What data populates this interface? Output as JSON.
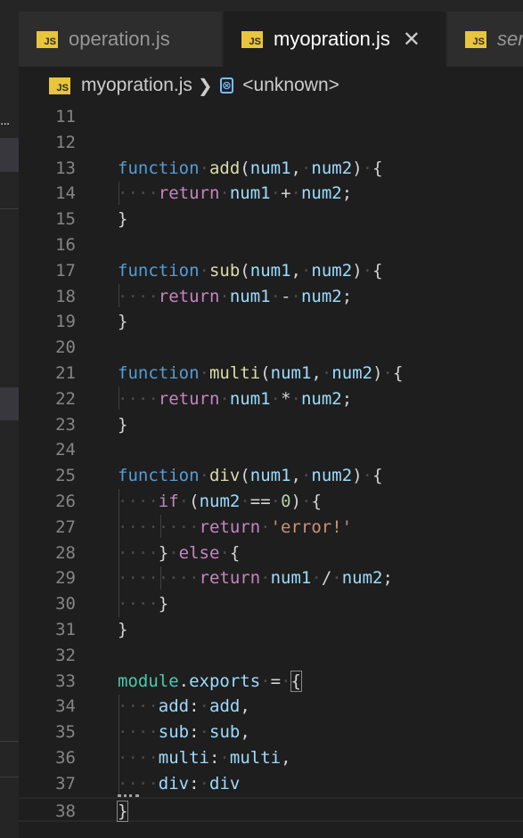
{
  "tabs": [
    {
      "label": "operation.js",
      "icon": "JS",
      "active": false
    },
    {
      "label": "myopration.js",
      "icon": "JS",
      "active": true,
      "close_glyph": "✕"
    },
    {
      "label": "ser",
      "icon": "JS",
      "active": false
    }
  ],
  "breadcrumb": {
    "file": "myopration.js",
    "icon": "JS",
    "separator": "❯",
    "symbol_icon": "⊗",
    "symbol": "<unknown>"
  },
  "sidebar": {
    "overflow": "..."
  },
  "editor": {
    "current_line": 38,
    "lines": [
      {
        "n": "11",
        "tokens": []
      },
      {
        "n": "12",
        "tokens": []
      },
      {
        "n": "13",
        "tokens": [
          [
            "kw",
            "function"
          ],
          [
            "ws",
            "·"
          ],
          [
            "fn",
            "add"
          ],
          [
            "op",
            "("
          ],
          [
            "pa",
            "num1"
          ],
          [
            "op",
            ","
          ],
          [
            "ws",
            "·"
          ],
          [
            "pa",
            "num2"
          ],
          [
            "op",
            ")"
          ],
          [
            "ws",
            "·"
          ],
          [
            "op",
            "{"
          ]
        ]
      },
      {
        "n": "14",
        "tokens": [
          [
            "ws",
            "····"
          ],
          [
            "kc",
            "return"
          ],
          [
            "ws",
            "·"
          ],
          [
            "pa",
            "num1"
          ],
          [
            "ws",
            "·"
          ],
          [
            "op",
            "+"
          ],
          [
            "ws",
            "·"
          ],
          [
            "pa",
            "num2"
          ],
          [
            "op",
            ";"
          ]
        ]
      },
      {
        "n": "15",
        "tokens": [
          [
            "op",
            "}"
          ]
        ]
      },
      {
        "n": "16",
        "tokens": []
      },
      {
        "n": "17",
        "tokens": [
          [
            "kw",
            "function"
          ],
          [
            "ws",
            "·"
          ],
          [
            "fn",
            "sub"
          ],
          [
            "op",
            "("
          ],
          [
            "pa",
            "num1"
          ],
          [
            "op",
            ","
          ],
          [
            "ws",
            "·"
          ],
          [
            "pa",
            "num2"
          ],
          [
            "op",
            ")"
          ],
          [
            "ws",
            "·"
          ],
          [
            "op",
            "{"
          ]
        ]
      },
      {
        "n": "18",
        "tokens": [
          [
            "ws",
            "····"
          ],
          [
            "kc",
            "return"
          ],
          [
            "ws",
            "·"
          ],
          [
            "pa",
            "num1"
          ],
          [
            "ws",
            "·"
          ],
          [
            "op",
            "-"
          ],
          [
            "ws",
            "·"
          ],
          [
            "pa",
            "num2"
          ],
          [
            "op",
            ";"
          ]
        ]
      },
      {
        "n": "19",
        "tokens": [
          [
            "op",
            "}"
          ]
        ]
      },
      {
        "n": "20",
        "tokens": []
      },
      {
        "n": "21",
        "tokens": [
          [
            "kw",
            "function"
          ],
          [
            "ws",
            "·"
          ],
          [
            "fn",
            "multi"
          ],
          [
            "op",
            "("
          ],
          [
            "pa",
            "num1"
          ],
          [
            "op",
            ","
          ],
          [
            "ws",
            "·"
          ],
          [
            "pa",
            "num2"
          ],
          [
            "op",
            ")"
          ],
          [
            "ws",
            "·"
          ],
          [
            "op",
            "{"
          ]
        ]
      },
      {
        "n": "22",
        "tokens": [
          [
            "ws",
            "····"
          ],
          [
            "kc",
            "return"
          ],
          [
            "ws",
            "·"
          ],
          [
            "pa",
            "num1"
          ],
          [
            "ws",
            "·"
          ],
          [
            "op",
            "*"
          ],
          [
            "ws",
            "·"
          ],
          [
            "pa",
            "num2"
          ],
          [
            "op",
            ";"
          ]
        ]
      },
      {
        "n": "23",
        "tokens": [
          [
            "op",
            "}"
          ]
        ]
      },
      {
        "n": "24",
        "tokens": []
      },
      {
        "n": "25",
        "tokens": [
          [
            "kw",
            "function"
          ],
          [
            "ws",
            "·"
          ],
          [
            "fn",
            "div"
          ],
          [
            "op",
            "("
          ],
          [
            "pa",
            "num1"
          ],
          [
            "op",
            ","
          ],
          [
            "ws",
            "·"
          ],
          [
            "pa",
            "num2"
          ],
          [
            "op",
            ")"
          ],
          [
            "ws",
            "·"
          ],
          [
            "op",
            "{"
          ]
        ]
      },
      {
        "n": "26",
        "tokens": [
          [
            "ws",
            "····"
          ],
          [
            "kc",
            "if"
          ],
          [
            "ws",
            "·"
          ],
          [
            "op",
            "("
          ],
          [
            "pa",
            "num2"
          ],
          [
            "ws",
            "·"
          ],
          [
            "op",
            "=="
          ],
          [
            "ws",
            "·"
          ],
          [
            "nu",
            "0"
          ],
          [
            "op",
            ")"
          ],
          [
            "ws",
            "·"
          ],
          [
            "op",
            "{"
          ]
        ]
      },
      {
        "n": "27",
        "tokens": [
          [
            "ws",
            "········"
          ],
          [
            "kc",
            "return"
          ],
          [
            "ws",
            "·"
          ],
          [
            "st",
            "'error!'"
          ]
        ]
      },
      {
        "n": "28",
        "tokens": [
          [
            "ws",
            "····"
          ],
          [
            "op",
            "}"
          ],
          [
            "ws",
            "·"
          ],
          [
            "kc",
            "else"
          ],
          [
            "ws",
            "·"
          ],
          [
            "op",
            "{"
          ]
        ]
      },
      {
        "n": "29",
        "tokens": [
          [
            "ws",
            "········"
          ],
          [
            "kc",
            "return"
          ],
          [
            "ws",
            "·"
          ],
          [
            "pa",
            "num1"
          ],
          [
            "ws",
            "·"
          ],
          [
            "op",
            "/"
          ],
          [
            "ws",
            "·"
          ],
          [
            "pa",
            "num2"
          ],
          [
            "op",
            ";"
          ]
        ]
      },
      {
        "n": "30",
        "tokens": [
          [
            "ws",
            "····"
          ],
          [
            "op",
            "}"
          ]
        ]
      },
      {
        "n": "31",
        "tokens": [
          [
            "op",
            "}"
          ]
        ]
      },
      {
        "n": "32",
        "tokens": []
      },
      {
        "n": "33",
        "tokens": [
          [
            "mo",
            "module"
          ],
          [
            "op",
            "."
          ],
          [
            "pa",
            "exports"
          ],
          [
            "ws",
            "·"
          ],
          [
            "op",
            "="
          ],
          [
            "ws",
            "·"
          ],
          [
            "br",
            "{"
          ]
        ]
      },
      {
        "n": "34",
        "tokens": [
          [
            "ws",
            "····"
          ],
          [
            "pa",
            "add"
          ],
          [
            "op",
            ":"
          ],
          [
            "ws",
            "·"
          ],
          [
            "pa",
            "add"
          ],
          [
            "op",
            ","
          ]
        ]
      },
      {
        "n": "35",
        "tokens": [
          [
            "ws",
            "····"
          ],
          [
            "pa",
            "sub"
          ],
          [
            "op",
            ":"
          ],
          [
            "ws",
            "·"
          ],
          [
            "pa",
            "sub"
          ],
          [
            "op",
            ","
          ]
        ]
      },
      {
        "n": "36",
        "tokens": [
          [
            "ws",
            "····"
          ],
          [
            "pa",
            "multi"
          ],
          [
            "op",
            ":"
          ],
          [
            "ws",
            "·"
          ],
          [
            "pa",
            "multi"
          ],
          [
            "op",
            ","
          ]
        ]
      },
      {
        "n": "37",
        "tokens": [
          [
            "ws",
            "····"
          ],
          [
            "pa",
            "div"
          ],
          [
            "op",
            ":"
          ],
          [
            "ws",
            "·"
          ],
          [
            "pa",
            "div"
          ]
        ]
      },
      {
        "n": "38",
        "tokens": [
          [
            "br",
            "}"
          ]
        ]
      }
    ]
  },
  "colors": {
    "editor_bg": "#1e1e1e",
    "tabbar_bg": "#252526",
    "keyword": "#569cd6",
    "control": "#c586c0",
    "function": "#dcdcaa",
    "variable": "#9cdcfe",
    "module": "#4ec9b0",
    "string": "#ce9178",
    "number": "#b5cea8",
    "js_icon": "#e8c53a"
  }
}
